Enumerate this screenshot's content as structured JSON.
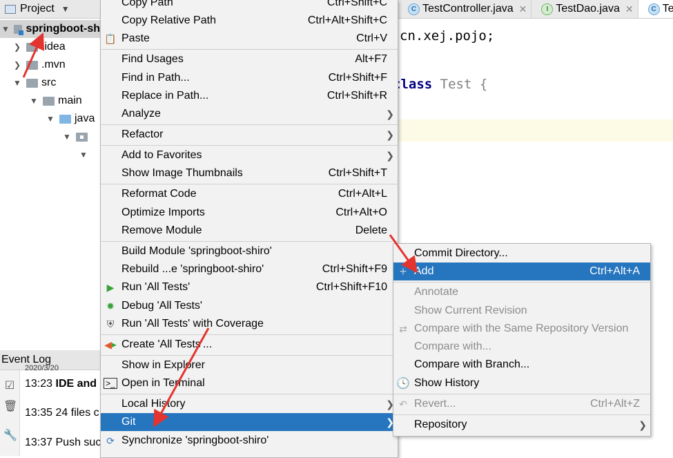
{
  "project_panel": {
    "title": "Project",
    "tree": [
      {
        "label": "springboot-sh",
        "bold": true
      },
      {
        "label": ".idea"
      },
      {
        "label": ".mvn"
      },
      {
        "label": "src"
      },
      {
        "label": "main"
      },
      {
        "label": "java"
      }
    ]
  },
  "editor": {
    "tabs": [
      {
        "label": "TestController.java"
      },
      {
        "label": "TestDao.java"
      },
      {
        "label": "Te"
      }
    ],
    "code_line1": "cn.xej.pojo;",
    "code_kw": "class",
    "code_name": "Test {"
  },
  "event_log": {
    "title": "Event Log",
    "partial_line": "2020/3/20",
    "rows": [
      {
        "time": "13:23",
        "text": "IDE and"
      },
      {
        "time": "13:35",
        "text": "24 files c"
      },
      {
        "time": "13:37",
        "text": "Push suc"
      }
    ]
  },
  "context_menu": {
    "items": [
      {
        "label": "Copy Path",
        "shortcut": "Ctrl+Shift+C"
      },
      {
        "label": "Copy Relative Path",
        "shortcut": "Ctrl+Alt+Shift+C"
      },
      {
        "label": "Paste",
        "shortcut": "Ctrl+V"
      },
      {
        "label": "Find Usages",
        "shortcut": "Alt+F7"
      },
      {
        "label": "Find in Path...",
        "shortcut": "Ctrl+Shift+F"
      },
      {
        "label": "Replace in Path...",
        "shortcut": "Ctrl+Shift+R"
      },
      {
        "label": "Analyze"
      },
      {
        "label": "Refactor"
      },
      {
        "label": "Add to Favorites"
      },
      {
        "label": "Show Image Thumbnails",
        "shortcut": "Ctrl+Shift+T"
      },
      {
        "label": "Reformat Code",
        "shortcut": "Ctrl+Alt+L"
      },
      {
        "label": "Optimize Imports",
        "shortcut": "Ctrl+Alt+O"
      },
      {
        "label": "Remove Module",
        "shortcut": "Delete"
      },
      {
        "label": "Build Module 'springboot-shiro'"
      },
      {
        "label": "Rebuild ...e 'springboot-shiro'",
        "shortcut": "Ctrl+Shift+F9"
      },
      {
        "label": "Run 'All Tests'",
        "shortcut": "Ctrl+Shift+F10"
      },
      {
        "label": "Debug 'All Tests'"
      },
      {
        "label": "Run 'All Tests' with Coverage"
      },
      {
        "label": "Create 'All Tests'..."
      },
      {
        "label": "Show in Explorer"
      },
      {
        "label": "Open in Terminal"
      },
      {
        "label": "Local History"
      },
      {
        "label": "Git"
      },
      {
        "label": "Synchronize 'springboot-shiro'"
      }
    ]
  },
  "git_submenu": {
    "items": [
      {
        "label": "Commit Directory..."
      },
      {
        "label": "Add",
        "shortcut": "Ctrl+Alt+A"
      },
      {
        "label": "Annotate"
      },
      {
        "label": "Show Current Revision"
      },
      {
        "label": "Compare with the Same Repository Version"
      },
      {
        "label": "Compare with..."
      },
      {
        "label": "Compare with Branch..."
      },
      {
        "label": "Show History"
      },
      {
        "label": "Revert...",
        "shortcut": "Ctrl+Alt+Z"
      },
      {
        "label": "Repository"
      }
    ]
  },
  "colors": {
    "highlight": "#2675bf",
    "annotation_arrow": "#e3342f",
    "keyword": "#000080"
  }
}
